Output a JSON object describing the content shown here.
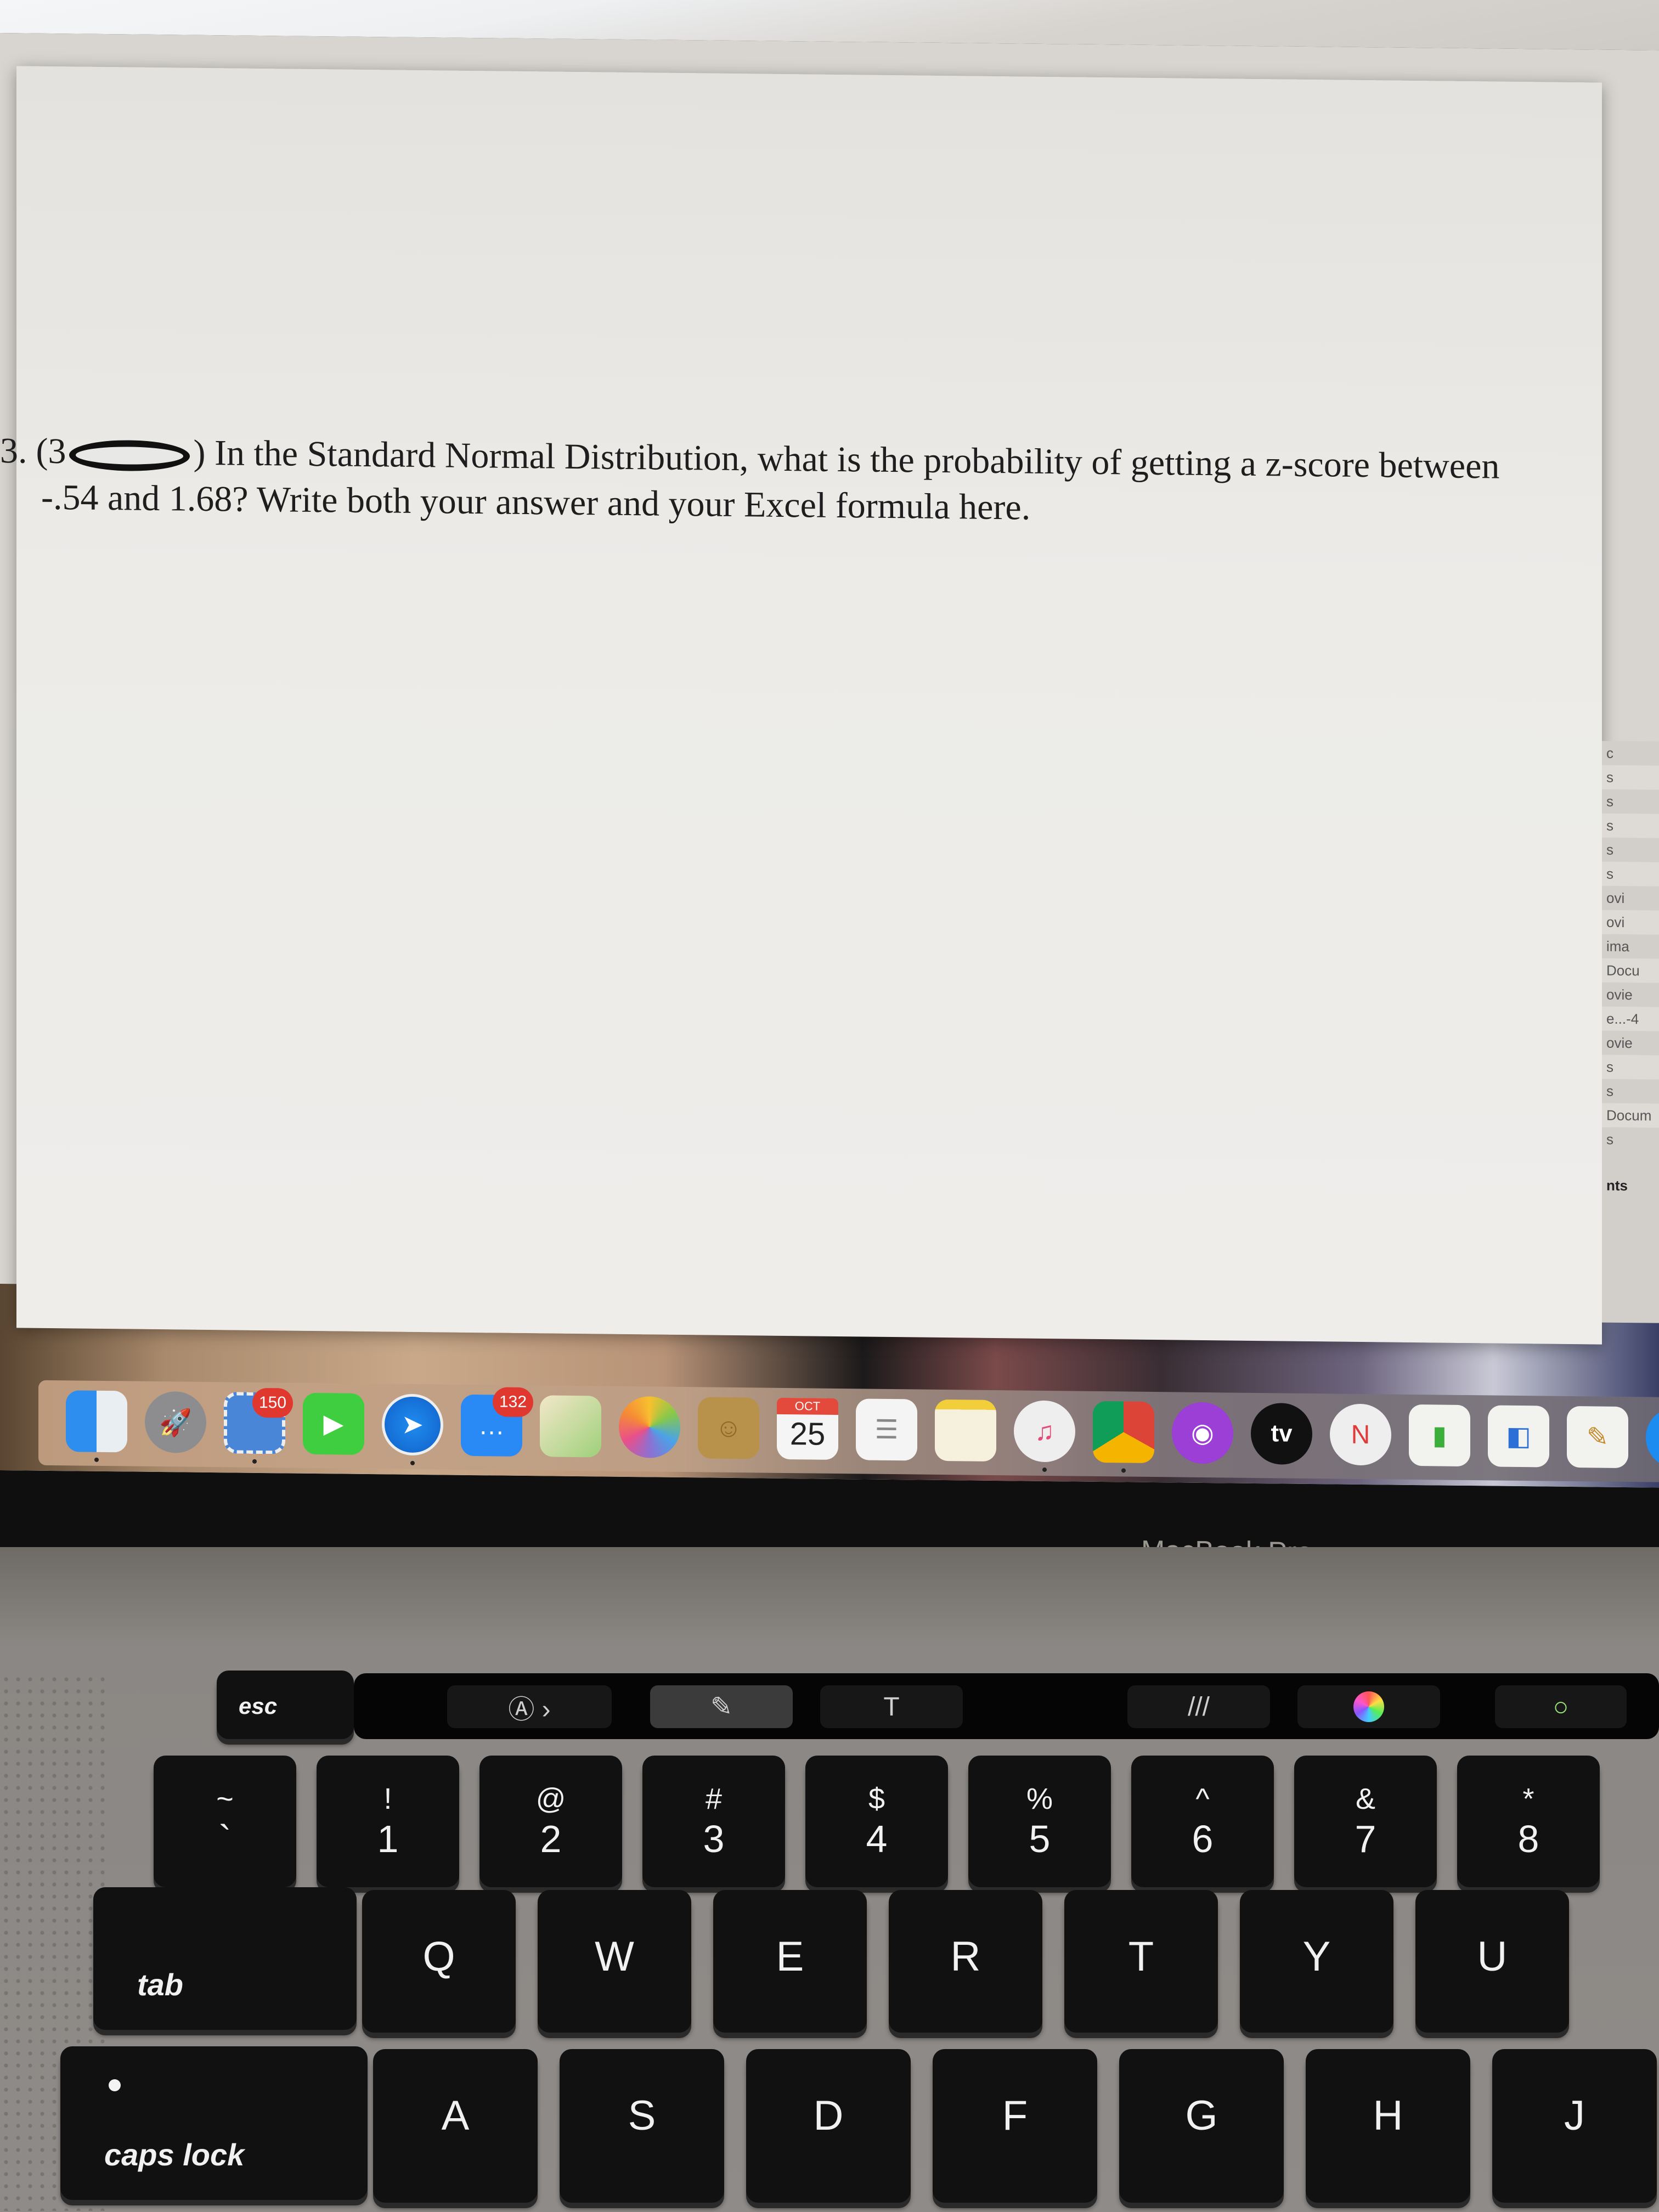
{
  "document": {
    "question_number": "3.",
    "points_prefix": "(3",
    "points_suffix": ")",
    "line1": "In the Standard Normal Distribution, what is the probability of getting a z-score between",
    "line2": "-.54 and 1.68? Write both your answer and your Excel formula here."
  },
  "finder_sidebar_fragments": [
    "c",
    "s",
    "s",
    "s",
    "s",
    "s",
    "ovi",
    "ovi",
    "ima",
    "Docu",
    "ovie",
    "e...-4",
    "ovie",
    "s",
    "s",
    "Docum",
    "s",
    "nts"
  ],
  "dock": {
    "apps": [
      {
        "name": "Finder",
        "icon": "finder-icon",
        "running": true
      },
      {
        "name": "Launchpad",
        "icon": "rocket-icon",
        "running": false
      },
      {
        "name": "Mail",
        "icon": "mail-stamp-icon",
        "badge": "150",
        "running": true
      },
      {
        "name": "FaceTime",
        "icon": "video-camera-icon",
        "running": false
      },
      {
        "name": "Safari",
        "icon": "compass-icon",
        "running": true
      },
      {
        "name": "Messages",
        "icon": "chat-bubble-icon",
        "badge": "132",
        "running": false
      },
      {
        "name": "Maps",
        "icon": "map-icon",
        "running": false
      },
      {
        "name": "Photos",
        "icon": "flower-icon",
        "running": false
      },
      {
        "name": "Contacts",
        "icon": "contacts-book-icon",
        "running": false
      },
      {
        "name": "Calendar",
        "icon": "calendar-icon",
        "month": "OCT",
        "day": "25",
        "running": false
      },
      {
        "name": "Reminders",
        "icon": "checklist-icon",
        "running": false
      },
      {
        "name": "Notes",
        "icon": "notepad-icon",
        "running": false
      },
      {
        "name": "Music",
        "icon": "music-note-icon",
        "running": true
      },
      {
        "name": "Chrome",
        "icon": "chrome-icon",
        "running": true
      },
      {
        "name": "Podcasts",
        "icon": "podcast-icon",
        "running": false
      },
      {
        "name": "TV",
        "icon": "apple-tv-icon",
        "label": "tv",
        "running": false
      },
      {
        "name": "News",
        "icon": "news-icon",
        "running": false
      },
      {
        "name": "Numbers",
        "icon": "bar-chart-icon",
        "running": false
      },
      {
        "name": "Keynote",
        "icon": "podium-icon",
        "running": false
      },
      {
        "name": "Pages",
        "icon": "pen-icon",
        "running": false
      },
      {
        "name": "App Store",
        "icon": "app-store-icon",
        "running": false
      }
    ]
  },
  "bezel": {
    "label": "MacBook Pro"
  },
  "touch_bar": {
    "esc": "esc",
    "controls": [
      {
        "name": "markup-annotate",
        "icon": "circle-a-icon"
      },
      {
        "name": "sketch",
        "icon": "sketch-pen-icon",
        "active": true
      },
      {
        "name": "text",
        "icon": "text-box-icon"
      },
      {
        "name": "line-width",
        "icon": "stroke-lines-icon"
      },
      {
        "name": "color",
        "icon": "color-wheel-icon"
      },
      {
        "name": "shape",
        "icon": "ring-icon"
      }
    ]
  },
  "keyboard": {
    "number_row": [
      {
        "sym": "~",
        "num": "`"
      },
      {
        "sym": "!",
        "num": "1"
      },
      {
        "sym": "@",
        "num": "2"
      },
      {
        "sym": "#",
        "num": "3"
      },
      {
        "sym": "$",
        "num": "4"
      },
      {
        "sym": "%",
        "num": "5"
      },
      {
        "sym": "^",
        "num": "6"
      },
      {
        "sym": "&",
        "num": "7"
      },
      {
        "sym": "*",
        "num": "8"
      }
    ],
    "top_row": [
      "Q",
      "W",
      "E",
      "R",
      "T",
      "Y",
      "U"
    ],
    "home_row": [
      "A",
      "S",
      "D",
      "F",
      "G",
      "H",
      "J"
    ],
    "tab": "tab",
    "caps_lock": "caps lock"
  }
}
